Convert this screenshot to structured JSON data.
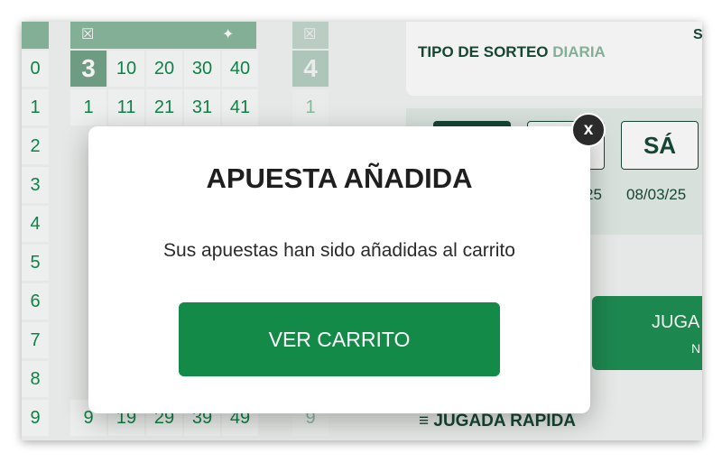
{
  "background": {
    "left_column": [
      "0",
      "1",
      "2",
      "3",
      "4",
      "5",
      "6",
      "7",
      "8",
      "9"
    ],
    "grid": {
      "header": "3",
      "header_cells": [
        "10",
        "20",
        "30",
        "40"
      ],
      "row_first": [
        "1",
        "11",
        "21",
        "31",
        "41"
      ],
      "row_last": [
        "9",
        "19",
        "29",
        "39",
        "49"
      ]
    },
    "second_grid": {
      "header": "4",
      "row_first": "1",
      "row_last": "9"
    },
    "panel": {
      "tipo_label": "TIPO DE SORTEO",
      "tipo_value": "DIARIA",
      "corner_letter": "S",
      "day_label": "SÁ",
      "date_left": "25",
      "date_right": "08/03/25",
      "play_button_line1": "JUGA",
      "play_button_line2": "N",
      "quick_play": "JUGADA RAPIDA"
    }
  },
  "modal": {
    "title": "APUESTA AÑADIDA",
    "message": "Sus apuestas han sido añadidas al carrito",
    "cta_label": "VER CARRITO",
    "close_label": "x"
  },
  "colors": {
    "primary_green": "#138a47",
    "dark_green": "#184a36",
    "muted_green": "#8cb9a0"
  }
}
